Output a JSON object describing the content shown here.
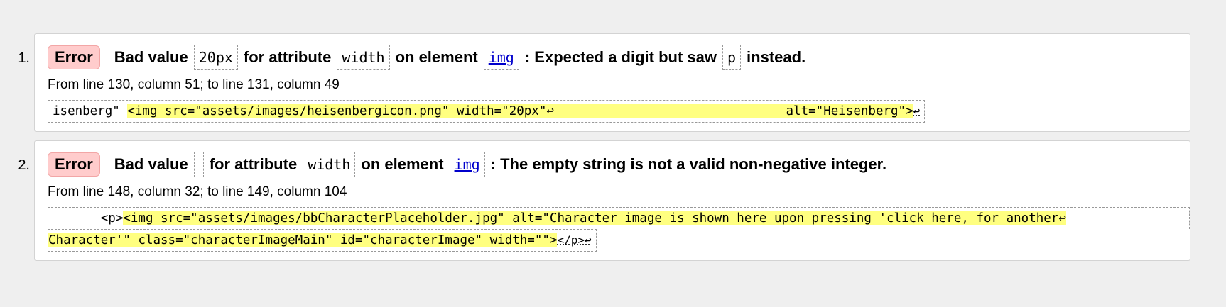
{
  "messages": [
    {
      "index": "1.",
      "type_label": "Error",
      "parts": {
        "p1": "Bad value",
        "c1": "20px",
        "p2": "for attribute",
        "c2": "width",
        "p3": "on element",
        "c3": "img",
        "p4": ": Expected a digit but saw",
        "c4": "p",
        "p5": "instead."
      },
      "location": "From line 130, column 51; to line 131, column 49",
      "extract": {
        "before": "isenberg\" ",
        "highlight": "<img src=\"assets/images/heisenbergicon.png\" width=\"20px\"↩                               alt=\"Heisenberg\">",
        "after": "↩"
      }
    },
    {
      "index": "2.",
      "type_label": "Error",
      "parts": {
        "p1": "Bad value",
        "c1": "",
        "p2": "for attribute",
        "c2": "width",
        "p3": "on element",
        "c3": "img",
        "p4": ": The empty string is not a valid non-negative integer."
      },
      "location": "From line 148, column 32; to line 149, column 104",
      "extract": {
        "before": "       <p>",
        "highlight_line1": "<img src=\"assets/images/bbCharacterPlaceholder.jpg\" alt=\"Character image is shown here upon pressing 'click here, for another↩",
        "highlight_line2": "Character'\" class=\"characterImageMain\" id=\"characterImage\" width=\"\">",
        "after": "</p>↩"
      }
    }
  ]
}
